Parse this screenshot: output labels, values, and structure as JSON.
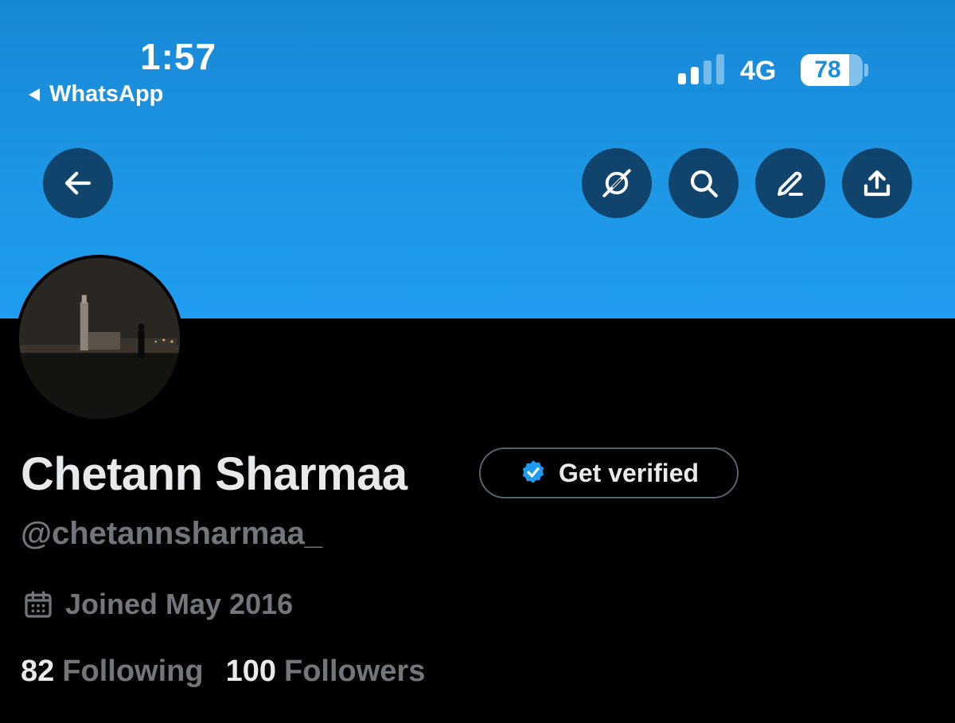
{
  "status_bar": {
    "time": "1:57",
    "back_app": "WhatsApp",
    "network": "4G",
    "battery_percent": "78",
    "battery_level": 0.78,
    "signal_bars_active": 2
  },
  "header": {
    "back_icon": "arrow-left-icon",
    "actions": [
      "grok-icon",
      "search-icon",
      "edit-icon",
      "share-icon"
    ]
  },
  "profile": {
    "name": "Chetann Sharmaa",
    "get_verified_label": "Get verified",
    "handle": "@chetannsharmaa_",
    "joined": "Joined May 2016",
    "following_count": "82",
    "following_label": "Following",
    "followers_count": "100",
    "followers_label": "Followers"
  },
  "colors": {
    "banner": "#1d96e4",
    "verified_blue": "#1d9bf0",
    "muted_text": "#71767b",
    "primary_text": "#e7e9ea"
  }
}
